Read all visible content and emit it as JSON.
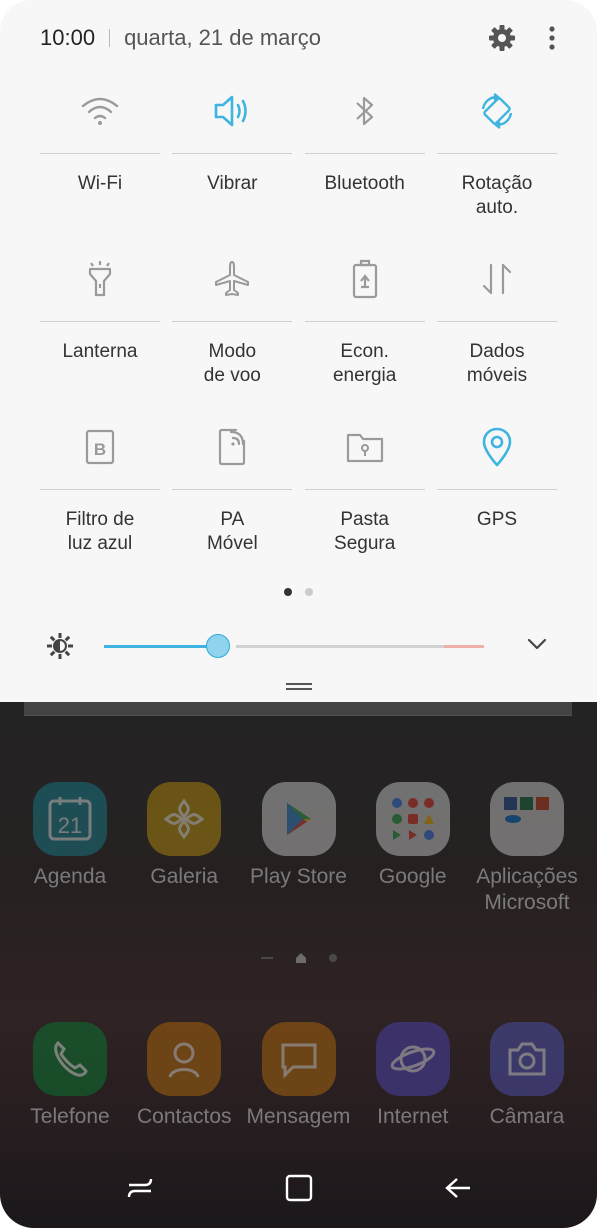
{
  "status": {
    "time": "10:00",
    "date": "quarta, 21 de março"
  },
  "colors": {
    "accent": "#3fb4e0",
    "inactive_icon": "#9a9a9a",
    "panel_bg": "#f7f7f7",
    "active_dot": "#333333",
    "inactive_dot": "#cccccc"
  },
  "quick_tiles": [
    {
      "label": "Wi-Fi",
      "icon": "wifi-icon",
      "active": false
    },
    {
      "label": "Vibrar",
      "icon": "vibrate-icon",
      "active": true
    },
    {
      "label": "Bluetooth",
      "icon": "bluetooth-icon",
      "active": false
    },
    {
      "label": "Rotação\nauto.",
      "icon": "auto-rotate-icon",
      "active": true
    },
    {
      "label": "Lanterna",
      "icon": "flashlight-icon",
      "active": false
    },
    {
      "label": "Modo\nde voo",
      "icon": "airplane-icon",
      "active": false
    },
    {
      "label": "Econ.\nenergia",
      "icon": "battery-saver-icon",
      "active": false
    },
    {
      "label": "Dados\nmóveis",
      "icon": "mobile-data-icon",
      "active": false
    },
    {
      "label": "Filtro de\nluz azul",
      "icon": "blue-light-filter-icon",
      "active": false
    },
    {
      "label": "PA\nMóvel",
      "icon": "mobile-hotspot-icon",
      "active": false
    },
    {
      "label": "Pasta\nSegura",
      "icon": "secure-folder-icon",
      "active": false
    },
    {
      "label": "GPS",
      "icon": "gps-icon",
      "active": true
    }
  ],
  "pager": {
    "pages": 2,
    "current": 1
  },
  "brightness": {
    "level": 0.3,
    "auto": true
  },
  "home_apps_row1": [
    {
      "label": "Agenda",
      "icon": "calendar-icon",
      "badge_text": "21",
      "color": "#1e8a9b"
    },
    {
      "label": "Galeria",
      "icon": "gallery-icon",
      "color": "#c79a12"
    },
    {
      "label": "Play Store",
      "icon": "play-store-icon",
      "color": "#d9d9d9"
    },
    {
      "label": "Google",
      "icon": "google-folder-icon",
      "color": "#d9d9d9"
    },
    {
      "label": "Aplicações\nMicrosoft",
      "icon": "microsoft-folder-icon",
      "color": "#d9d9d9"
    }
  ],
  "home_apps_dock": [
    {
      "label": "Telefone",
      "icon": "phone-icon",
      "color": "#0f8a3c"
    },
    {
      "label": "Contactos",
      "icon": "contacts-icon",
      "color": "#c8780f"
    },
    {
      "label": "Mensagem",
      "icon": "messages-icon",
      "color": "#c8780f"
    },
    {
      "label": "Internet",
      "icon": "internet-icon",
      "color": "#5a4fc8"
    },
    {
      "label": "Câmara",
      "icon": "camera-icon",
      "color": "#5a5fc8"
    }
  ]
}
